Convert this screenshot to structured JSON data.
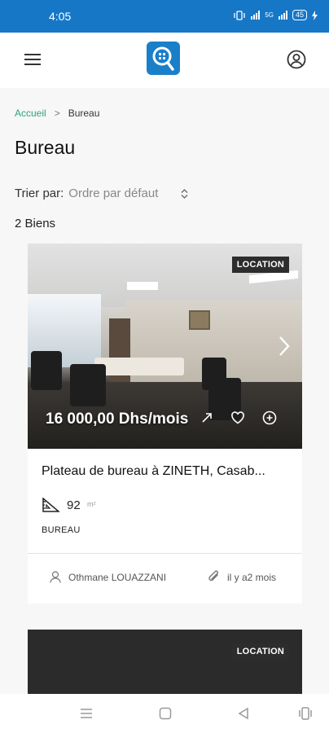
{
  "status_bar": {
    "time": "4:05",
    "network": "5G",
    "battery": "45"
  },
  "header": {
    "menu_icon": "hamburger-menu-icon",
    "logo_icon": "search-location-logo-icon",
    "user_icon": "user-circle-icon"
  },
  "breadcrumb": {
    "home": "Accueil",
    "separator": ">",
    "current": "Bureau"
  },
  "page": {
    "title": "Bureau"
  },
  "sort": {
    "label": "Trier par:",
    "value": "Ordre par défaut"
  },
  "results": {
    "count_label": "2 Biens"
  },
  "listings": [
    {
      "badge": "LOCATION",
      "price": "16 000,00 Dhs/mois",
      "title": "Plateau de bureau à ZINETH, Casab...",
      "area": "92",
      "area_unit": "m²",
      "category": "BUREAU",
      "agent": "Othmane LOUAZZANI",
      "posted": "il y a2 mois"
    },
    {
      "badge": "LOCATION"
    }
  ],
  "colors": {
    "status_bar": "#1677c7",
    "accent_green": "#2fa47a",
    "logo_blue": "#1a7fc9"
  }
}
